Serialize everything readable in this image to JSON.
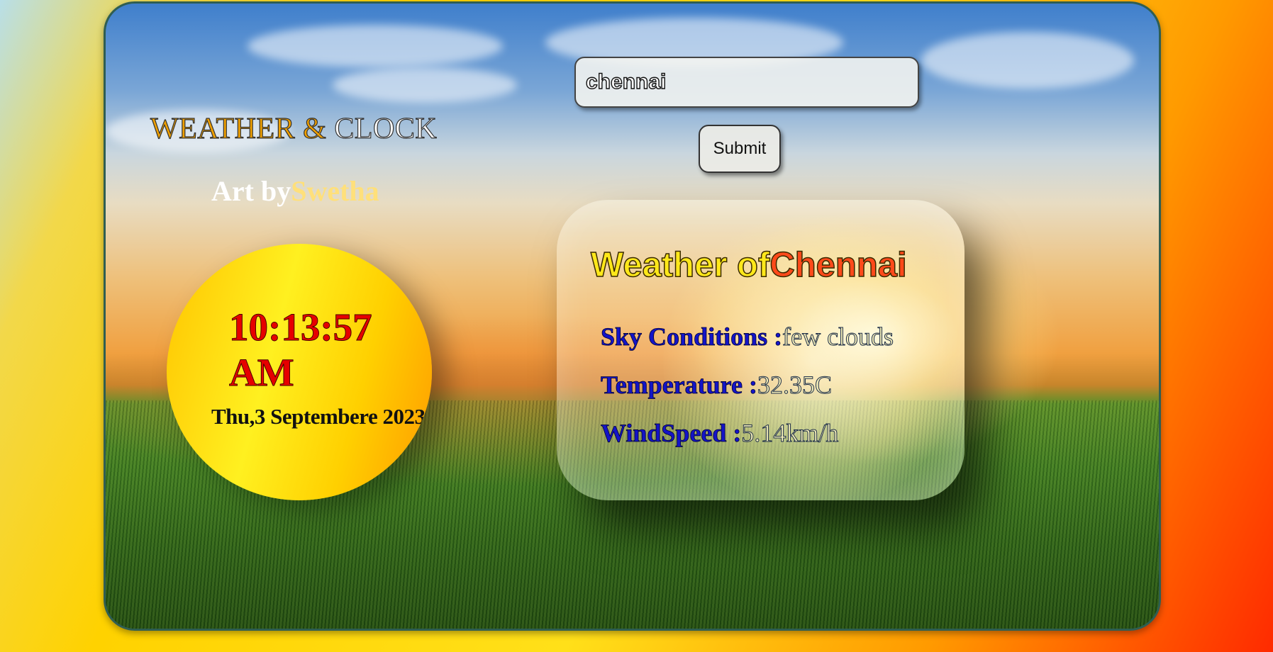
{
  "header": {
    "title_word1": "WEATHER",
    "title_amp": "&",
    "title_word2": "CLOCK",
    "art_prefix": "Art by",
    "art_name": "Swetha"
  },
  "clock": {
    "time": "10:13:57 AM",
    "date": "Thu,3 Septembere 2023"
  },
  "search": {
    "value": "chennai",
    "submit_label": "Submit"
  },
  "weather": {
    "heading_prefix": "Weather of",
    "city": "Chennai",
    "rows": [
      {
        "label": "Sky Conditions :",
        "value": "few clouds"
      },
      {
        "label": "Temperature :",
        "value": "32.35C"
      },
      {
        "label": "WindSpeed :",
        "value": "5.14km/h"
      }
    ]
  },
  "colors": {
    "title_accent": "#f0a000",
    "time_color": "#e60000",
    "city_color": "#ff4a1a",
    "label_color": "#1414c8"
  }
}
